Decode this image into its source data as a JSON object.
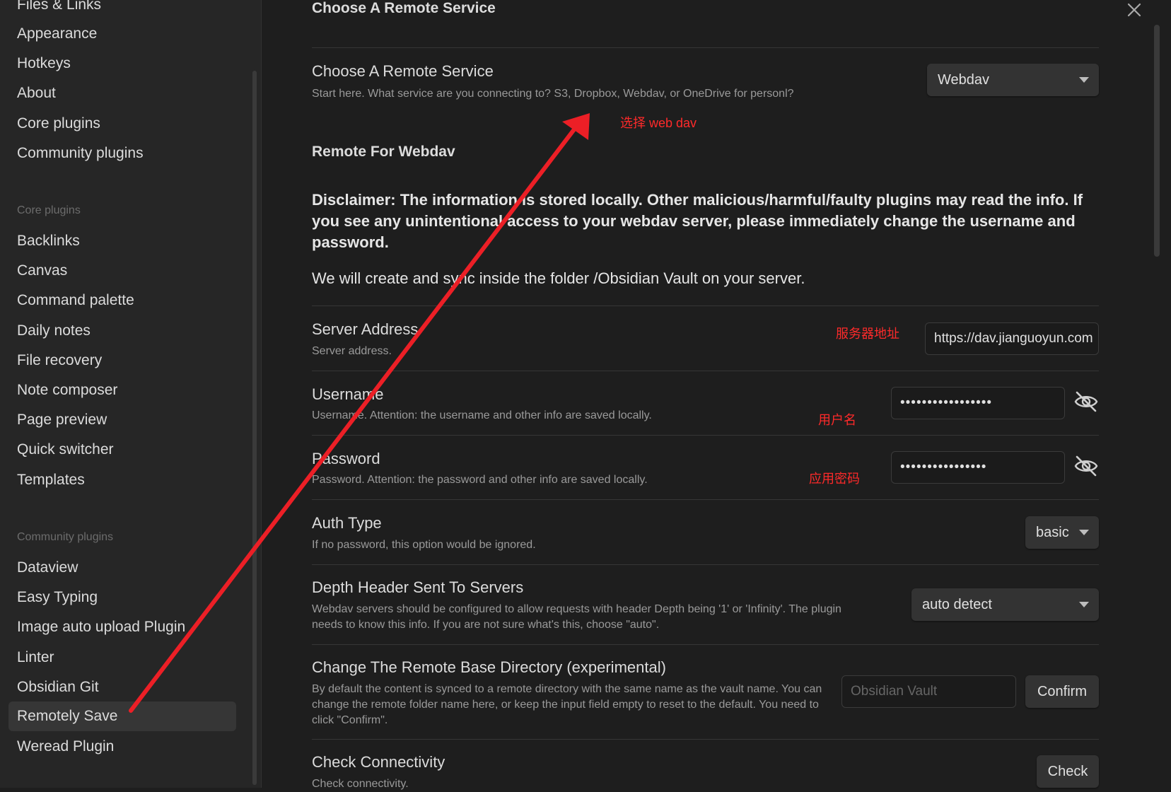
{
  "sidebar": {
    "top_items": [
      "Files & Links",
      "Appearance",
      "Hotkeys",
      "About",
      "Core plugins",
      "Community plugins"
    ],
    "core_heading": "Core plugins",
    "core_items": [
      "Backlinks",
      "Canvas",
      "Command palette",
      "Daily notes",
      "File recovery",
      "Note composer",
      "Page preview",
      "Quick switcher",
      "Templates"
    ],
    "community_heading": "Community plugins",
    "community_items": [
      "Dataview",
      "Easy Typing",
      "Image auto upload Plugin",
      "Linter",
      "Obsidian Git",
      "Remotely Save",
      "Weread Plugin"
    ]
  },
  "main": {
    "top_title": "Choose A Remote Service",
    "service": {
      "title": "Choose A Remote Service",
      "desc": "Start here. What service are you connecting to? S3, Dropbox, Webdav, or OneDrive for personl?",
      "value": "Webdav"
    },
    "remote_title": "Remote For Webdav",
    "disclaimer": "Disclaimer: The information is stored locally. Other malicious/harmful/faulty plugins may read the info. If you see any unintentional access to your webdav server, please immediately change the username and password.",
    "note": "We will create and sync inside the folder /Obsidian Vault on your server.",
    "server": {
      "title": "Server Address",
      "desc": "Server address.",
      "value": "https://dav.jianguoyun.com"
    },
    "username": {
      "title": "Username",
      "desc": "Username. Attention: the username and other info are saved locally.",
      "value": "•••••••••••••••••"
    },
    "password": {
      "title": "Password",
      "desc": "Password. Attention: the password and other info are saved locally.",
      "value": "••••••••••••••••"
    },
    "auth": {
      "title": "Auth Type",
      "desc": "If no password, this option would be ignored.",
      "value": "basic"
    },
    "depth": {
      "title": "Depth Header Sent To Servers",
      "desc": "Webdav servers should be configured to allow requests with header Depth being '1' or 'Infinity'. The plugin needs to know this info. If you are not sure what's this, choose \"auto\".",
      "value": "auto detect"
    },
    "basedir": {
      "title": "Change The Remote Base Directory (experimental)",
      "desc": "By default the content is synced to a remote directory with the same name as the vault name. You can change the remote folder name here, or keep the input field empty to reset to the default. You need to click \"Confirm\".",
      "placeholder": "Obsidian Vault",
      "confirm": "Confirm"
    },
    "check": {
      "title": "Check Connectivity",
      "desc": "Check connectivity.",
      "button": "Check"
    }
  },
  "annotations": {
    "choose": "选择 web dav",
    "server": "服务器地址",
    "username": "用户名",
    "password": "应用密码",
    "color": "#ff2a2a"
  }
}
